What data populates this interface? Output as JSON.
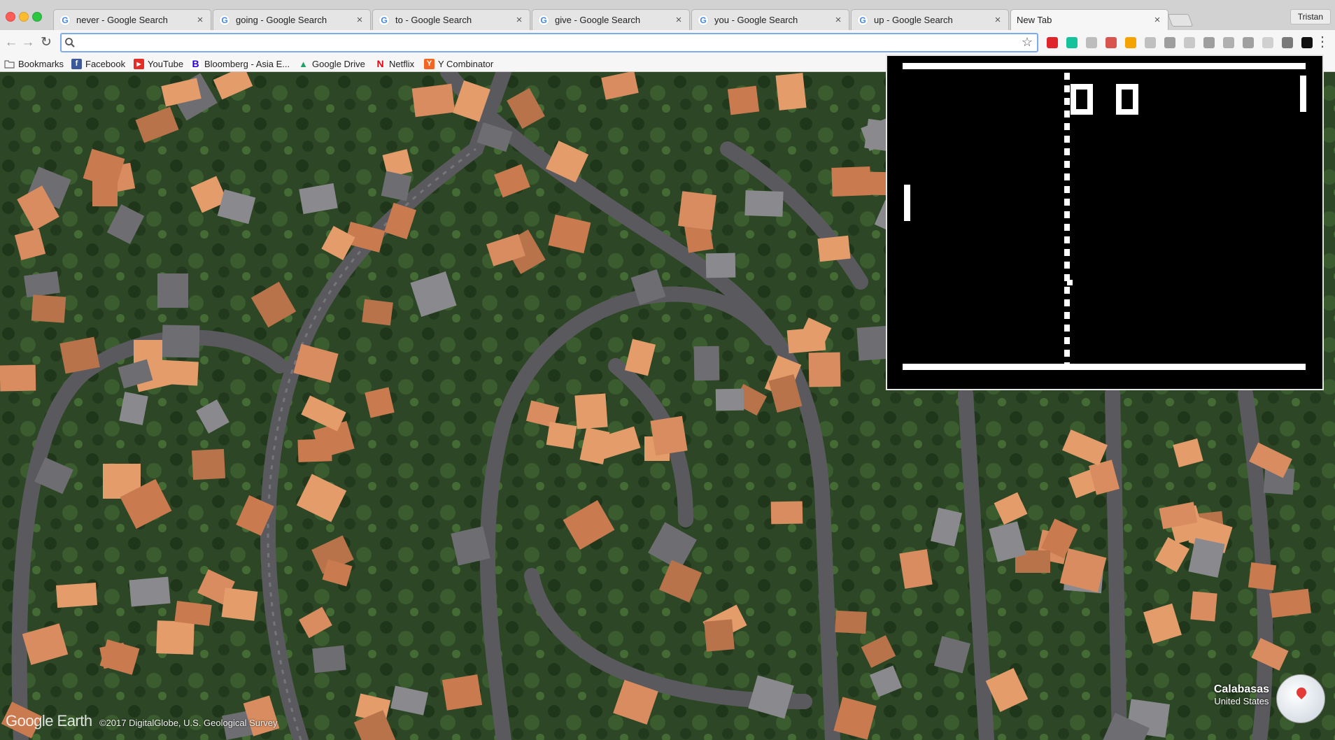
{
  "window": {
    "profile_name": "Tristan"
  },
  "tabs": [
    {
      "title": "never - Google Search",
      "favicon": "G",
      "active": false
    },
    {
      "title": "going - Google Search",
      "favicon": "G",
      "active": false
    },
    {
      "title": "to - Google Search",
      "favicon": "G",
      "active": false
    },
    {
      "title": "give - Google Search",
      "favicon": "G",
      "active": false
    },
    {
      "title": "you - Google Search",
      "favicon": "G",
      "active": false
    },
    {
      "title": "up - Google Search",
      "favicon": "G",
      "active": false
    },
    {
      "title": "New Tab",
      "favicon": "",
      "active": true
    }
  ],
  "toolbar": {
    "omnibox_value": "",
    "icons": [
      "back-arrow",
      "forward-arrow",
      "reload",
      "search",
      "bookmark-star"
    ]
  },
  "extensions": [
    {
      "name": "opera-icon",
      "color": "#e0242b"
    },
    {
      "name": "grammarly-icon",
      "color": "#15c39a"
    },
    {
      "name": "search-extension-icon",
      "color": "#bdbdbd"
    },
    {
      "name": "plus-extension-icon",
      "color": "#d9534f"
    },
    {
      "name": "colorful-extension-icon",
      "color": "#f4a300"
    },
    {
      "name": "extension-icon",
      "color": "#c0c0c0"
    },
    {
      "name": "cast-icon",
      "color": "#9e9e9e"
    },
    {
      "name": "extension-icon",
      "color": "#c8c8c8"
    },
    {
      "name": "gear-extension-icon",
      "color": "#9e9e9e"
    },
    {
      "name": "extension-icon",
      "color": "#b0b0b0"
    },
    {
      "name": "extension-icon",
      "color": "#a0a0a0"
    },
    {
      "name": "extension-icon",
      "color": "#d0d0d0"
    },
    {
      "name": "bird-extension-icon",
      "color": "#7a7a7a"
    },
    {
      "name": "pong-extension-icon",
      "color": "#111111"
    }
  ],
  "bookmarks": [
    {
      "label": "Bookmarks",
      "icon": "folder-icon",
      "color": "#9e9e9e"
    },
    {
      "label": "Facebook",
      "icon": "facebook-icon",
      "color": "#3b5998",
      "glyph": "f"
    },
    {
      "label": "YouTube",
      "icon": "youtube-icon",
      "color": "#e52d27",
      "glyph": "▶"
    },
    {
      "label": "Bloomberg - Asia E...",
      "icon": "bloomberg-icon",
      "color": "#2800d7",
      "glyph": "B"
    },
    {
      "label": "Google Drive",
      "icon": "google-drive-icon",
      "color": "#1fa463",
      "glyph": "▲"
    },
    {
      "label": "Netflix",
      "icon": "netflix-icon",
      "color": "#e50914",
      "glyph": "N"
    },
    {
      "label": "Y Combinator",
      "icon": "ycombinator-icon",
      "color": "#f26522",
      "glyph": "Y"
    }
  ],
  "earth": {
    "logo": "Google Earth",
    "credit": "©2017 DigitalGlobe, U.S. Geological Survey",
    "place_name": "Calabasas",
    "place_country": "United States"
  },
  "pong": {
    "left_score": "0",
    "right_score": "0",
    "colors": {
      "background": "#000000",
      "foreground": "#ffffff"
    }
  }
}
